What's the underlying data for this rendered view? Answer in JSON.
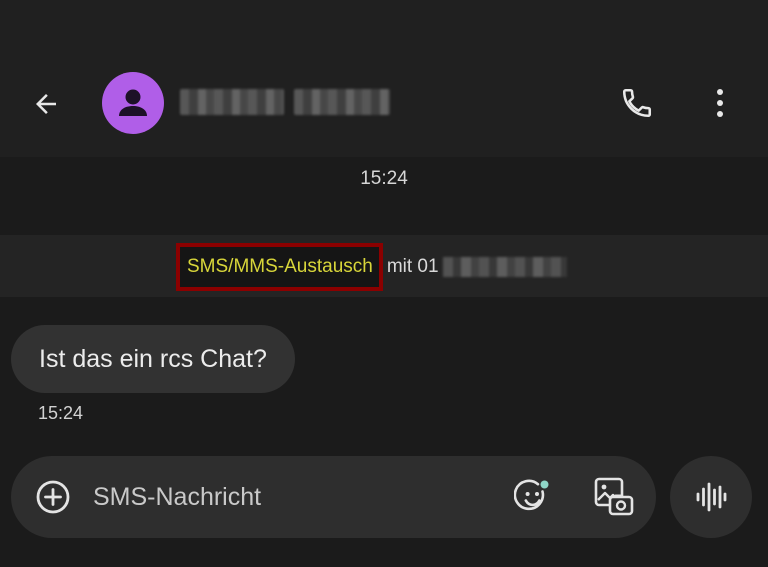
{
  "header": {
    "back_icon": "arrow-back-icon",
    "avatar_icon": "person-icon",
    "contact_name": "",
    "call_icon": "phone-icon",
    "menu_icon": "more-vert-icon"
  },
  "conversation": {
    "top_timestamp": "15:24",
    "info": {
      "highlighted_label": "SMS/MMS-Austausch",
      "rest_text": "mit 01"
    },
    "messages": [
      {
        "text": "Ist das ein rcs Chat?",
        "time": "15:24"
      }
    ]
  },
  "composer": {
    "placeholder": "SMS-Nachricht",
    "value": "",
    "plus_icon": "add-circle-icon",
    "emoji_icon": "emoji-add-icon",
    "gallery_icon": "gallery-icon",
    "voice_icon": "voice-waveform-icon"
  },
  "colors": {
    "background": "#1b1b1b",
    "avatar": "#b05ee8",
    "highlight_border": "#8b0000",
    "highlight_text": "#d8d63a",
    "bubble": "#323232"
  }
}
